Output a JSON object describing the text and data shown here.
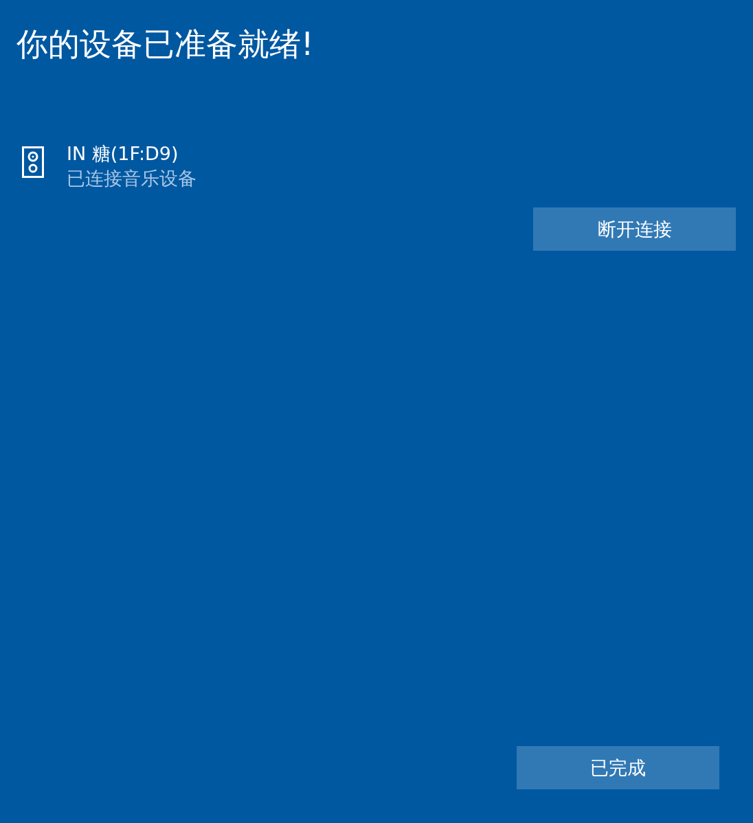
{
  "title": "你的设备已准备就绪!",
  "device": {
    "name": "IN 糖(1F:D9)",
    "status": "已连接音乐设备"
  },
  "disconnect_button": {
    "label": "断开连接"
  },
  "done_button": {
    "label": "已完成"
  }
}
